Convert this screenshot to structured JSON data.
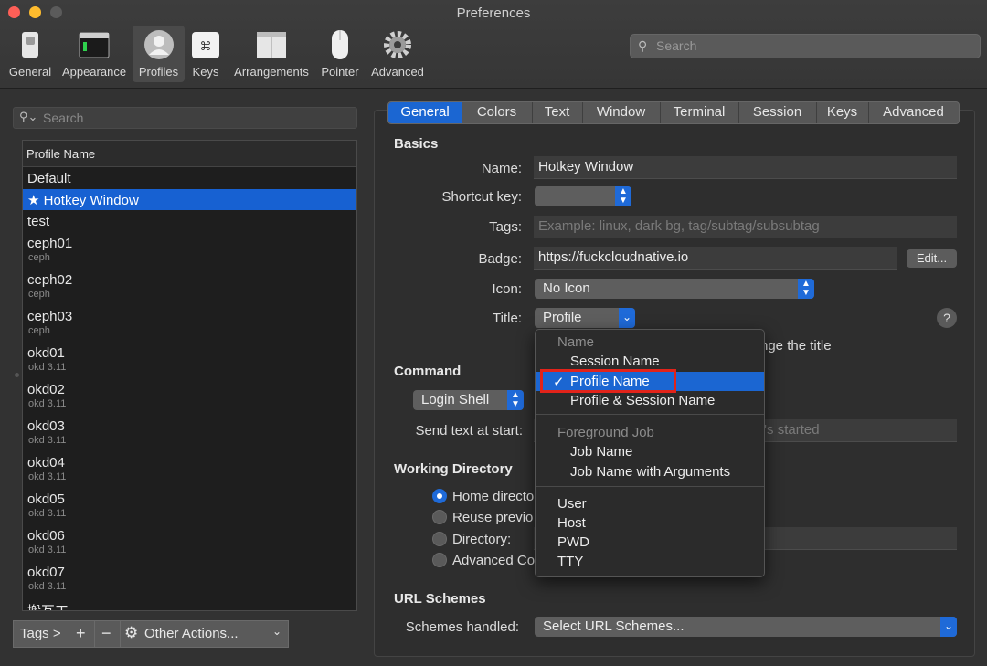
{
  "window": {
    "title": "Preferences"
  },
  "traffic_lights": {
    "close": "#fe5f57",
    "minimize": "#febc2e",
    "maximize": "#5b5b5b"
  },
  "toolbar": {
    "items": [
      {
        "label": "General",
        "icon": "switch-icon"
      },
      {
        "label": "Appearance",
        "icon": "terminal-window-icon"
      },
      {
        "label": "Profiles",
        "icon": "user-silhouette-icon",
        "selected": true
      },
      {
        "label": "Keys",
        "icon": "command-key-icon"
      },
      {
        "label": "Arrangements",
        "icon": "window-layout-icon"
      },
      {
        "label": "Pointer",
        "icon": "mouse-icon"
      },
      {
        "label": "Advanced",
        "icon": "gear-icon"
      }
    ],
    "search_placeholder": "Search"
  },
  "profiles": {
    "search_placeholder": "Search",
    "column_header": "Profile Name",
    "items": [
      {
        "name": "Default",
        "tag": ""
      },
      {
        "name": "★ Hotkey Window",
        "tag": "",
        "selected": true
      },
      {
        "name": "test",
        "tag": ""
      },
      {
        "name": "ceph01",
        "tag": "ceph"
      },
      {
        "name": "ceph02",
        "tag": "ceph"
      },
      {
        "name": "ceph03",
        "tag": "ceph"
      },
      {
        "name": "okd01",
        "tag": "okd 3.11"
      },
      {
        "name": "okd02",
        "tag": "okd 3.11"
      },
      {
        "name": "okd03",
        "tag": "okd 3.11"
      },
      {
        "name": "okd04",
        "tag": "okd 3.11"
      },
      {
        "name": "okd05",
        "tag": "okd 3.11"
      },
      {
        "name": "okd06",
        "tag": "okd 3.11"
      },
      {
        "name": "okd07",
        "tag": "okd 3.11"
      },
      {
        "name": "搬瓦工",
        "tag": ""
      }
    ],
    "bottom": {
      "tags": "Tags >",
      "add": "+",
      "remove": "−",
      "other_actions": "Other Actions..."
    }
  },
  "tabs": [
    {
      "label": "General",
      "selected": true
    },
    {
      "label": "Colors"
    },
    {
      "label": "Text"
    },
    {
      "label": "Window"
    },
    {
      "label": "Terminal"
    },
    {
      "label": "Session"
    },
    {
      "label": "Keys"
    },
    {
      "label": "Advanced"
    }
  ],
  "basics": {
    "heading": "Basics",
    "name_label": "Name:",
    "name_value": "Hotkey Window",
    "shortcut_label": "Shortcut key:",
    "tags_label": "Tags:",
    "tags_placeholder": "Example: linux, dark bg, tag/subtag/subsubtag",
    "badge_label": "Badge:",
    "badge_value": "https://fuckcloudnative.io",
    "edit_button": "Edit...",
    "icon_label": "Icon:",
    "icon_value": "No Icon",
    "title_label": "Title:",
    "title_value": "Profile",
    "title_note_partial": "nge the title"
  },
  "command": {
    "heading": "Command",
    "shell_value": "Login Shell",
    "send_text_label": "Send text at start:",
    "send_text_partial": "t's started"
  },
  "working_directory": {
    "heading": "Working Directory",
    "options": [
      {
        "label": "Home directo",
        "selected": true
      },
      {
        "label": "Reuse previo"
      },
      {
        "label": "Directory:"
      },
      {
        "label": "Advanced Co"
      }
    ]
  },
  "url_schemes": {
    "heading": "URL Schemes",
    "label": "Schemes handled:",
    "value": "Select URL Schemes..."
  },
  "title_menu": {
    "items": [
      {
        "label": "Name",
        "type": "header"
      },
      {
        "label": "Session Name"
      },
      {
        "label": "Profile Name",
        "checked": true,
        "highlighted": true
      },
      {
        "label": "Profile & Session Name"
      },
      {
        "label": "Foreground Job",
        "type": "header"
      },
      {
        "label": "Job Name"
      },
      {
        "label": "Job Name with Arguments"
      },
      {
        "label": "User"
      },
      {
        "label": "Host"
      },
      {
        "label": "PWD"
      },
      {
        "label": "TTY"
      }
    ],
    "check_mark": "✓"
  },
  "help_button": "?",
  "colors": {
    "accent": "#1b66d2",
    "highlight_box": "#e2231a"
  }
}
